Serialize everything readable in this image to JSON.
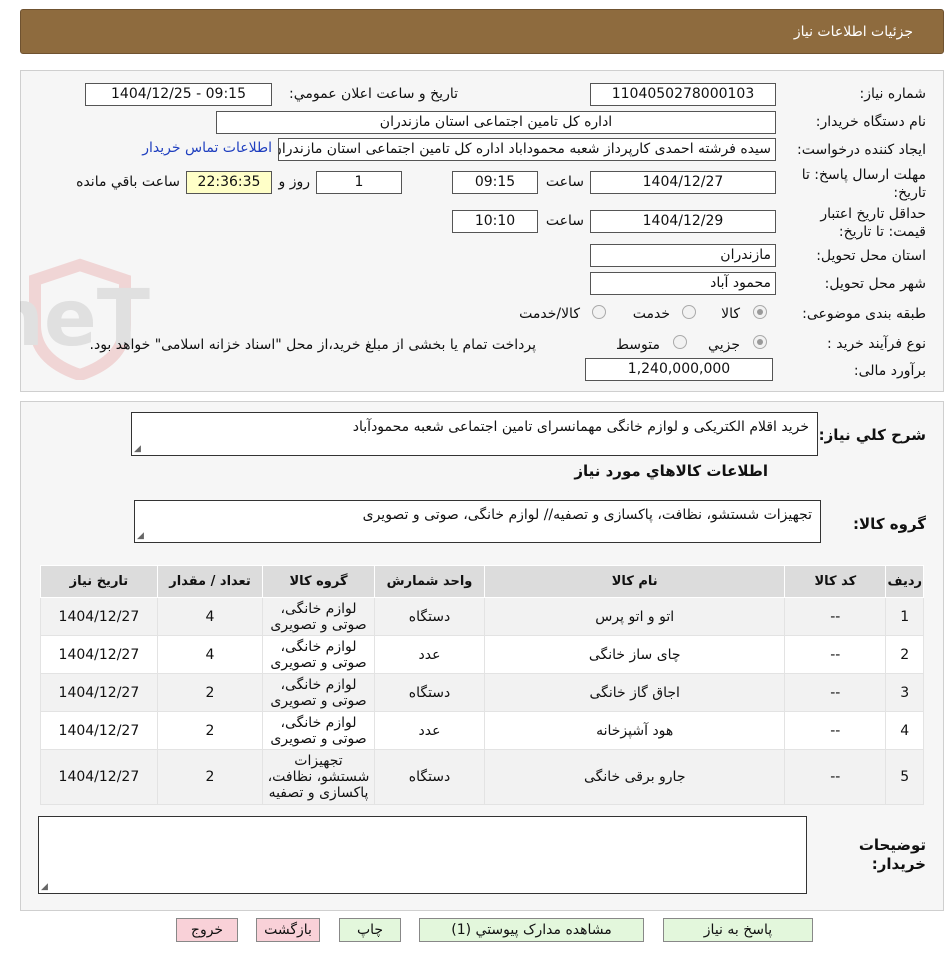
{
  "header": {
    "title": "جزئیات اطلاعات نیاز"
  },
  "watermark": {
    "text": "AriaTender.neT"
  },
  "details": {
    "need_number_label": "شماره نیاز:",
    "need_number": "1104050278000103",
    "announce_label": "تاریخ و ساعت اعلان عمومي:",
    "announce_value": "1404/12/25 - 09:15",
    "buyer_org_label": "نام دستگاه خريدار:",
    "buyer_org": "اداره کل تامین اجتماعی استان مازندران",
    "requester_label": "ايجاد کننده درخواست:",
    "requester": "سیده فرشته احمدی کارپرداز شعبه محموداباد اداره کل تامین اجتماعی استان مازندران",
    "contact_link": "اطلاعات تماس خريدار",
    "deadline_label": "مهلت ارسال پاسخ: تا تاریخ:",
    "deadline_date": "1404/12/27",
    "time_label": "ساعت",
    "deadline_time": "09:15",
    "days_value": "1",
    "days_label": "روز و",
    "remaining_time": "22:36:35",
    "remaining_label": "ساعت باقي مانده",
    "validity_label": "حداقل تاریخ اعتبار قیمت: تا تاریخ:",
    "validity_date": "1404/12/29",
    "validity_time": "10:10",
    "province_label": "استان محل تحویل:",
    "province": "مازندران",
    "city_label": "شهر محل تحویل:",
    "city": "محمود آباد",
    "category_label": "طبقه بندی موضوعی:",
    "category_options": [
      "کالا",
      "خدمت",
      "کالا/خدمت"
    ],
    "category_selected": "کالا",
    "process_label": "نوع فرآیند خرید :",
    "process_options": [
      "جزيي",
      "متوسط"
    ],
    "process_selected": "جزيي",
    "process_note": "پرداخت تمام یا بخشی از مبلغ خرید،از محل \"اسناد خزانه اسلامی\" خواهد بود.",
    "budget_label": "برآورد مالی:",
    "budget": "1,240,000,000"
  },
  "summary": {
    "label": "شرح کلي نياز:",
    "text": "خرید اقلام الکتریکی و لوازم خانگی مهمانسرای تامین اجتماعی شعبه محمودآباد",
    "items_title": "اطلاعات کالاهاي مورد نياز",
    "group_label": "گروه کالا:",
    "group_text": "تجهیزات شستشو، نظافت، پاکسازی و تصفیه// لوازم خانگی، صوتی و تصویری"
  },
  "table": {
    "headers": [
      "رديف",
      "کد کالا",
      "نام کالا",
      "واحد شمارش",
      "گروه کالا",
      "تعداد / مقدار",
      "تاريخ نياز"
    ],
    "rows": [
      [
        "1",
        "--",
        "اتو و اتو پرس",
        "دستگاه",
        "لوازم خانگی، صوتی و تصویری",
        "4",
        "1404/12/27"
      ],
      [
        "2",
        "--",
        "چای ساز خانگی",
        "عدد",
        "لوازم خانگی، صوتی و تصویری",
        "4",
        "1404/12/27"
      ],
      [
        "3",
        "--",
        "اجاق گاز خانگی",
        "دستگاه",
        "لوازم خانگی، صوتی و تصویری",
        "2",
        "1404/12/27"
      ],
      [
        "4",
        "--",
        "هود آشپزخانه",
        "عدد",
        "لوازم خانگی، صوتی و تصویری",
        "2",
        "1404/12/27"
      ],
      [
        "5",
        "--",
        "جارو برقی خانگی",
        "دستگاه",
        "تجهیزات شستشو، نظافت، پاکسازی و تصفیه",
        "2",
        "1404/12/27"
      ]
    ]
  },
  "notes": {
    "label": "توضیحات خریدار:",
    "text": ""
  },
  "buttons": {
    "reply": "پاسخ به نياز",
    "attachments": "مشاهده مدارک پيوستي (1)",
    "print": "چاپ",
    "back": "بازگشت",
    "exit": "خروج"
  }
}
